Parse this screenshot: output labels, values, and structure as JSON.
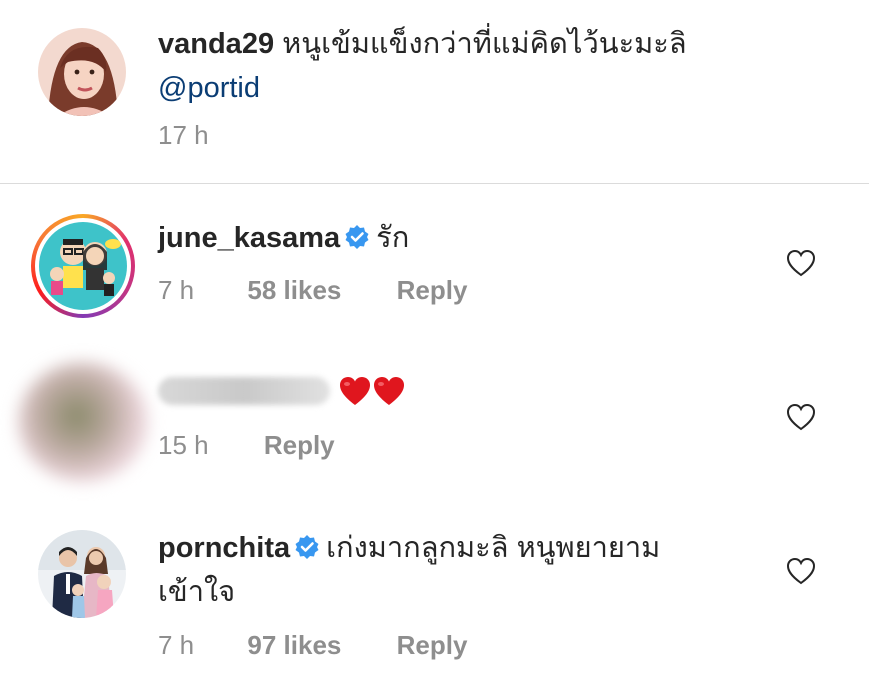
{
  "comments": [
    {
      "username": "vanda29",
      "text": "หนูเข้มแข็งกว่าที่แม่คิดไว้นะมะลิ",
      "mention": "@portid",
      "time": "17 h"
    },
    {
      "username": "june_kasama",
      "verified": true,
      "text": "รัก",
      "time": "7 h",
      "likes": "58 likes",
      "reply": "Reply"
    },
    {
      "username": "",
      "text": "❤❤",
      "time": "15 h",
      "reply": "Reply"
    },
    {
      "username": "pornchita",
      "verified": true,
      "text": "เก่งมากลูกมะลิ หนูพยายาม",
      "text_line2": "เข้าใจ",
      "time": "7 h",
      "likes": "97 likes",
      "reply": "Reply"
    }
  ],
  "colors": {
    "verified": "#3897f0",
    "mention": "#0b3d74",
    "muted": "#8e8e8e",
    "heart_emoji": "#e0161e"
  }
}
